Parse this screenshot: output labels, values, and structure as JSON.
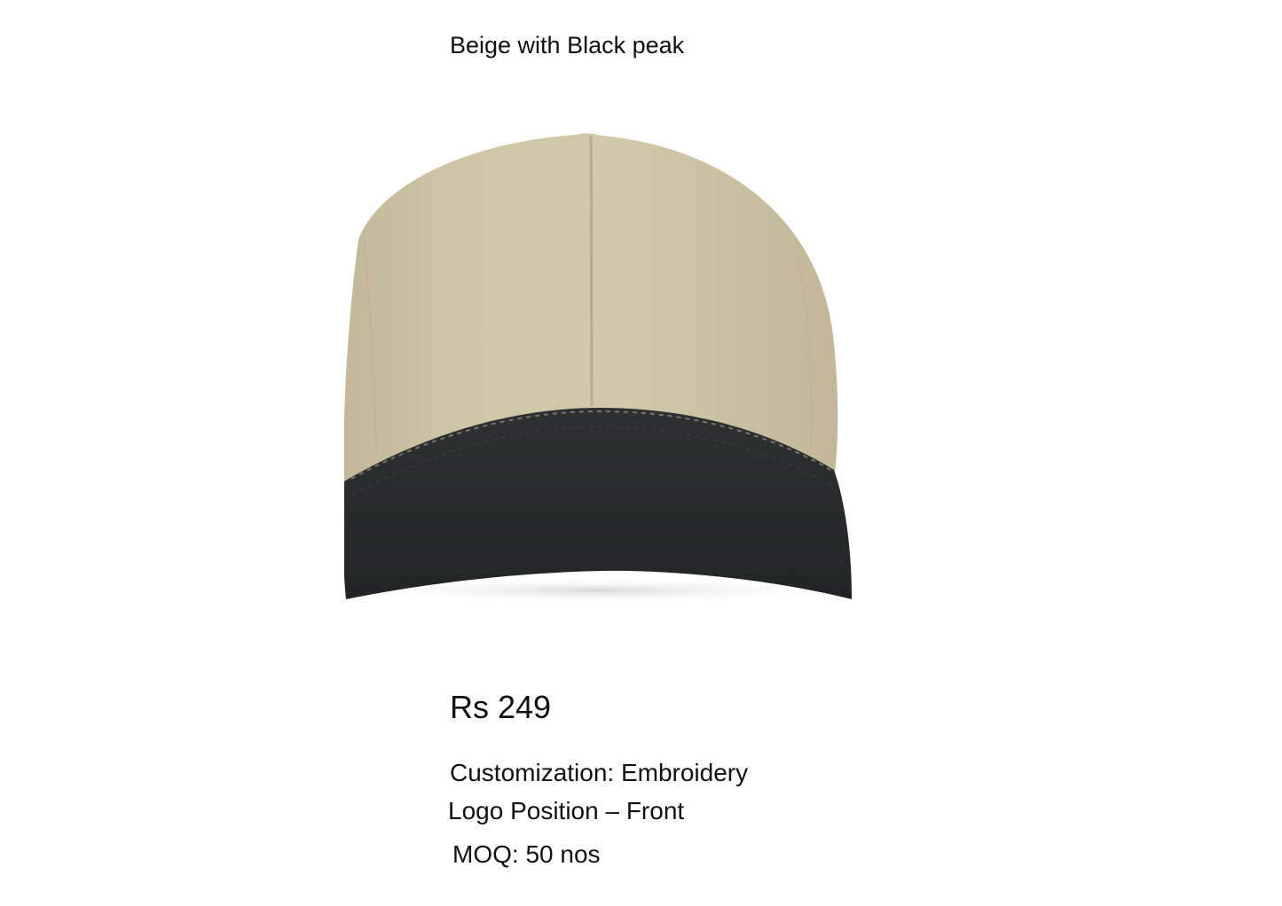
{
  "product": {
    "title": "Beige with Black peak",
    "price": "Rs 249",
    "customization": "Customization: Embroidery",
    "logo_position": "Logo Position – Front",
    "moq": "MOQ: 50 nos",
    "image": {
      "subject": "cap",
      "crown_color": "#cdc3a4",
      "peak_color": "#2b2c2d"
    }
  }
}
